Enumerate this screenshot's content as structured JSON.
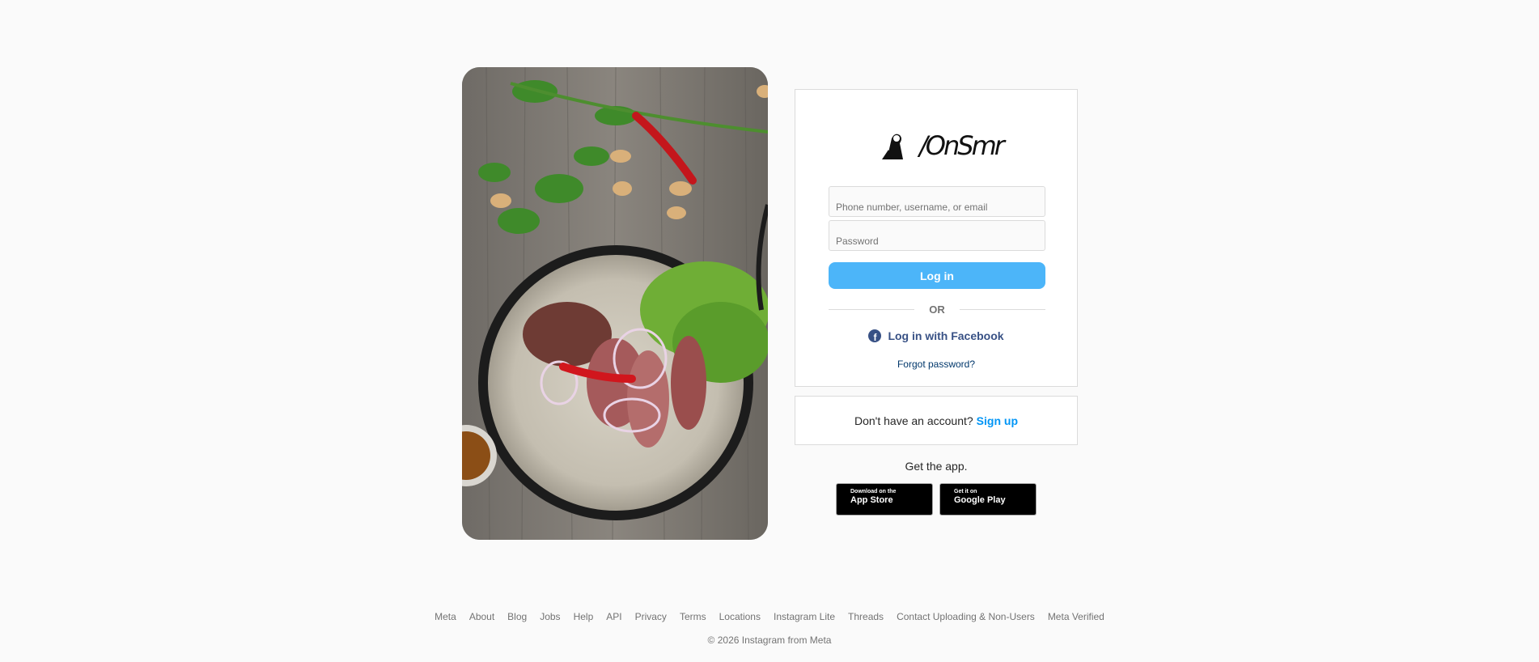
{
  "hero": {
    "alt_semantic": "food-photo"
  },
  "brand": {
    "wordmark": "/OnSmr"
  },
  "login": {
    "username_placeholder": "Phone number, username, or email",
    "password_placeholder": "Password",
    "login_label": "Log in",
    "or_label": "OR",
    "facebook_login_label": "Log in with Facebook",
    "forgot_password_label": "Forgot password?"
  },
  "signup": {
    "prompt": "Don't have an account?",
    "link_label": "Sign up"
  },
  "get_app": {
    "label": "Get the app.",
    "app_store": {
      "small": "Download on the",
      "big": "App Store"
    },
    "google_play": {
      "small": "Get it on",
      "big": "Google Play"
    }
  },
  "footer": {
    "links": [
      "Meta",
      "About",
      "Blog",
      "Jobs",
      "Help",
      "API",
      "Privacy",
      "Terms",
      "Locations",
      "Instagram Lite",
      "Threads",
      "Contact Uploading & Non-Users",
      "Meta Verified"
    ],
    "copyright": "© 2026 Instagram from Meta"
  },
  "colors": {
    "background": "#fafafa",
    "login_button": "#4cb5f9",
    "facebook": "#385185",
    "signup_link": "#0095f6",
    "forgot_link": "#00376b"
  },
  "icons": {
    "brand": "brand-logo-icon",
    "facebook": "facebook-icon",
    "apple": "apple-icon",
    "google_play": "google-play-icon"
  }
}
